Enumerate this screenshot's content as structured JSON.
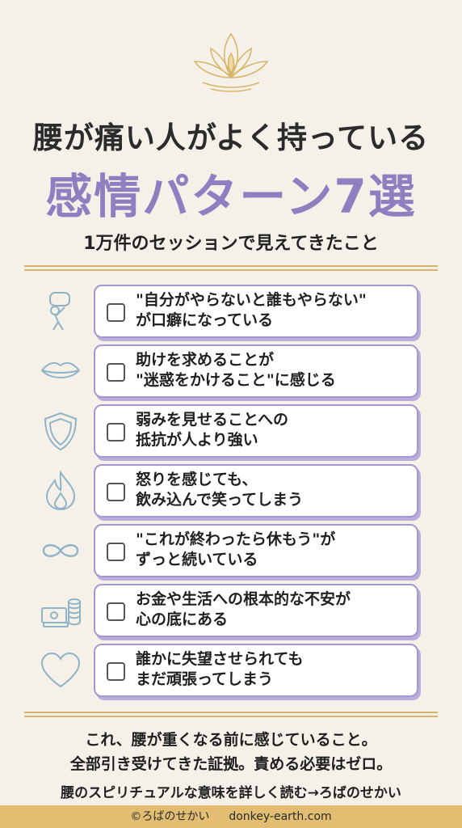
{
  "header": {
    "title_line1": "腰が痛い人がよく持っている",
    "title_line2": "感情パターン7選",
    "subtitle": "1万件のセッションで見えてきたこと",
    "logo_icon": "lotus-flame-icon"
  },
  "items": [
    {
      "icon": "carrying-burden-icon",
      "line1": "\"自分がやらないと誰もやらない\"",
      "line2": "が口癖になっている"
    },
    {
      "icon": "lips-icon",
      "line1": "助けを求めることが",
      "line2": "\"迷惑をかけること\"に感じる"
    },
    {
      "icon": "shield-icon",
      "line1": "弱みを見せることへの",
      "line2": "抵抗が人より強い"
    },
    {
      "icon": "flame-icon",
      "line1": "怒りを感じても、",
      "line2": "飲み込んで笑ってしまう"
    },
    {
      "icon": "infinity-icon",
      "line1": "\"これが終わったら休もう\"が",
      "line2": "ずっと続いている"
    },
    {
      "icon": "money-coins-icon",
      "line1": "お金や生活への根本的な不安が",
      "line2": "心の底にある"
    },
    {
      "icon": "heart-icon",
      "line1": "誰かに失望させられても",
      "line2": "まだ頑張ってしまう"
    }
  ],
  "closing": {
    "line1": "これ、腰が重くなる前に感じていること。",
    "line2": "全部引き受けてきた証拠。責める必要はゼロ。"
  },
  "link_text": "腰のスピリチュアルな意味を詳しく読む→ろばのせかい",
  "footer": {
    "copyright": "©ろばのせかい",
    "domain": "donkey-earth.com"
  },
  "colors": {
    "background": "#f5f1e8",
    "accent_purple": "#8f7fc0",
    "card_border": "#a597cf",
    "gold": "#d7b46a",
    "footer_bar": "#e2bd72"
  }
}
